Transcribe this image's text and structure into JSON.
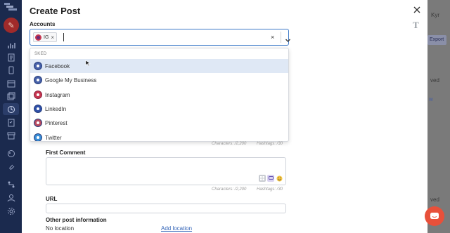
{
  "modal": {
    "title": "Create Post",
    "accounts_label": "Accounts",
    "selected_chip": "IG",
    "chip_remove": "×",
    "clear": "×"
  },
  "dropdown": {
    "group_label": "SKED",
    "options": [
      {
        "label": "Facebook",
        "icon": "facebook-account-avatar"
      },
      {
        "label": "Google My Business",
        "icon": "google-account-avatar"
      },
      {
        "label": "Instagram",
        "icon": "instagram-account-avatar"
      },
      {
        "label": "LinkedIn",
        "icon": "linkedin-account-avatar"
      },
      {
        "label": "Pinterest",
        "icon": "pinterest-account-avatar"
      },
      {
        "label": "Twitter",
        "icon": "twitter-account-avatar"
      }
    ],
    "highlighted": "Facebook"
  },
  "caption_meta": {
    "characters": "Characters: /2,200",
    "hashtags": "Hashtags: /30"
  },
  "first_comment": {
    "label": "First Comment",
    "characters": "Characters: /2,200",
    "hashtags": "Hashtags: /30"
  },
  "url": {
    "label": "URL",
    "value": ""
  },
  "other_info": {
    "label": "Other post information",
    "location": "No location",
    "add_location": "Add location"
  },
  "background": {
    "top_text": "Kyr",
    "export": "Export",
    "saved1": "ved",
    "view": "w",
    "saved2": "ved"
  },
  "colors": {
    "nav_bg": "#1b2a4e",
    "accent": "#3b78c8",
    "hover": "#dfe8f5",
    "chat": "#e8503a",
    "compose": "#a02a2a"
  }
}
